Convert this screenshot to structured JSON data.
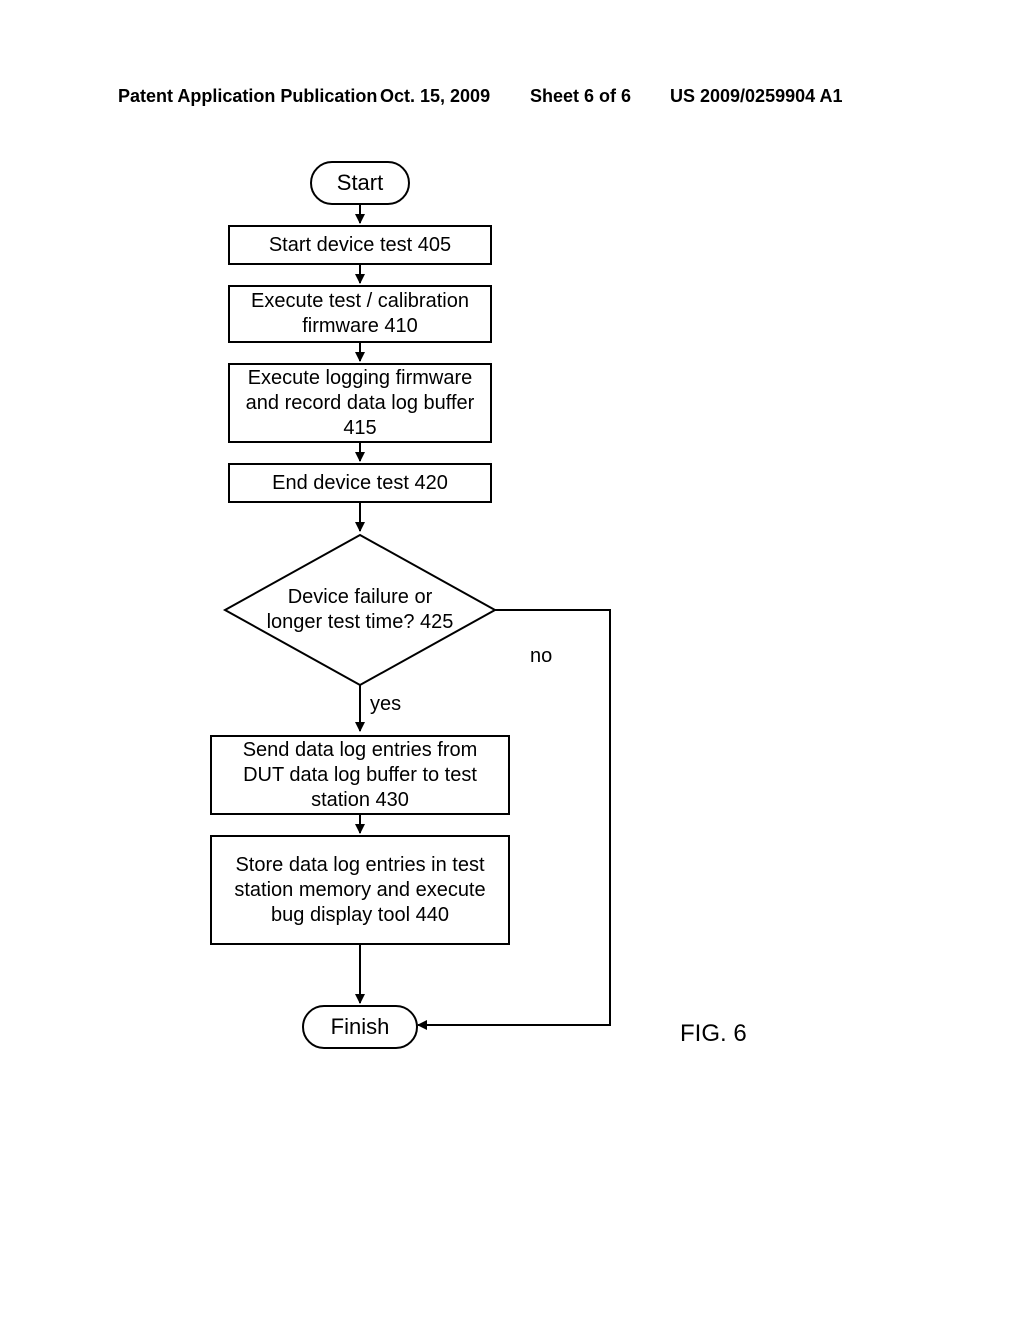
{
  "header": {
    "left": "Patent Application Publication",
    "date": "Oct. 15, 2009",
    "sheet": "Sheet 6 of 6",
    "docnum": "US 2009/0259904 A1"
  },
  "flow": {
    "start": "Start",
    "step405": "Start device test 405",
    "step410": "Execute test / calibration firmware 410",
    "step415": "Execute logging firmware and record data log buffer 415",
    "step420": "End device test 420",
    "decision425": "Device failure or longer test time? 425",
    "yes": "yes",
    "no": "no",
    "step430": "Send data log entries from DUT data log buffer to test station 430",
    "step440": "Store data log entries in test station memory and execute bug display tool 440",
    "finish": "Finish"
  },
  "figure_label": "FIG. 6",
  "chart_data": {
    "type": "flowchart",
    "title": "FIG. 6",
    "nodes": [
      {
        "id": "start",
        "type": "terminator",
        "label": "Start"
      },
      {
        "id": "405",
        "type": "process",
        "label": "Start device test 405"
      },
      {
        "id": "410",
        "type": "process",
        "label": "Execute test / calibration firmware 410"
      },
      {
        "id": "415",
        "type": "process",
        "label": "Execute logging firmware and record data log buffer 415"
      },
      {
        "id": "420",
        "type": "process",
        "label": "End device test 420"
      },
      {
        "id": "425",
        "type": "decision",
        "label": "Device failure or longer test time? 425"
      },
      {
        "id": "430",
        "type": "process",
        "label": "Send data log entries from DUT data log buffer to test station 430"
      },
      {
        "id": "440",
        "type": "process",
        "label": "Store data log entries in test station memory and execute bug display tool 440"
      },
      {
        "id": "finish",
        "type": "terminator",
        "label": "Finish"
      }
    ],
    "edges": [
      {
        "from": "start",
        "to": "405"
      },
      {
        "from": "405",
        "to": "410"
      },
      {
        "from": "410",
        "to": "415"
      },
      {
        "from": "415",
        "to": "420"
      },
      {
        "from": "420",
        "to": "425"
      },
      {
        "from": "425",
        "to": "430",
        "label": "yes"
      },
      {
        "from": "425",
        "to": "finish",
        "label": "no"
      },
      {
        "from": "430",
        "to": "440"
      },
      {
        "from": "440",
        "to": "finish"
      }
    ]
  }
}
